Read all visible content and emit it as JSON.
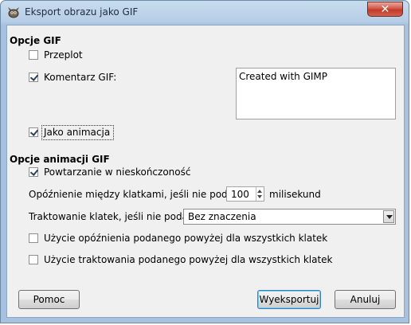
{
  "window": {
    "title": "Eksport obrazu jako GIF",
    "close_glyph": "✕",
    "icon": "gimp-icon"
  },
  "gif_options": {
    "heading": "Opcje GIF",
    "interlace": {
      "label": "Przeplot",
      "checked": false
    },
    "comment": {
      "label": "Komentarz GIF:",
      "checked": true,
      "value": "Created with GIMP"
    },
    "as_animation": {
      "label": "Jako animacja",
      "checked": true
    }
  },
  "animation_options": {
    "heading": "Opcje animacji GIF",
    "loop": {
      "label": "Powtarzanie w nieskończoność",
      "checked": true
    },
    "delay": {
      "label": "Opóźnienie między klatkami, jeśli nie podano:",
      "value": "100",
      "unit": "milisekund"
    },
    "disposal": {
      "label": "Traktowanie klatek, jeśli nie podano:",
      "value": "Bez znaczenia"
    },
    "use_delay_all": {
      "label": "Użycie opóźnienia podanego powyżej dla wszystkich klatek",
      "checked": false
    },
    "use_disposal_all": {
      "label": "Użycie traktowania podanego powyżej dla wszystkich klatek",
      "checked": false
    }
  },
  "buttons": {
    "help": "Pomoc",
    "export": "Wyeksportuj",
    "cancel": "Anuluj"
  }
}
